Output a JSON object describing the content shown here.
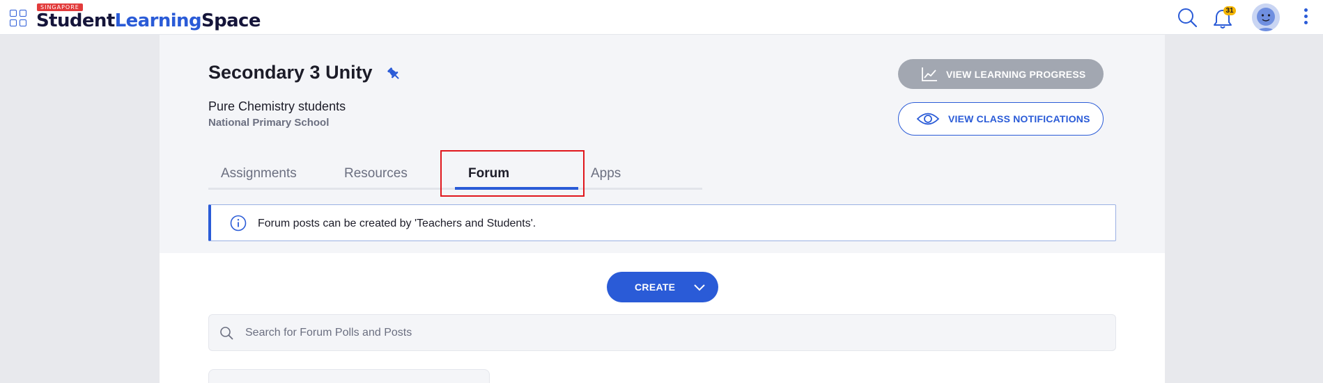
{
  "header": {
    "logo_badge": "SINGAPORE",
    "logo_word_1": "Student",
    "logo_word_2": "Learning",
    "logo_word_3": "Space",
    "notification_count": "31",
    "icons": [
      "apps-grid-icon",
      "search-icon",
      "bell-icon",
      "avatar",
      "more-vertical-icon"
    ]
  },
  "class": {
    "title": "Secondary 3 Unity",
    "subtitle": "Pure Chemistry students",
    "school": "National Primary School"
  },
  "actions": {
    "view_progress": "VIEW LEARNING PROGRESS",
    "view_notifications": "VIEW CLASS NOTIFICATIONS"
  },
  "tabs": [
    {
      "label": "Assignments",
      "active": false
    },
    {
      "label": "Resources",
      "active": false
    },
    {
      "label": "Forum",
      "active": true
    },
    {
      "label": "Apps",
      "active": false
    }
  ],
  "info_banner": {
    "text": "Forum posts can be created by 'Teachers and Students'."
  },
  "create": {
    "label": "CREATE"
  },
  "search": {
    "placeholder": "Search for Forum Polls and Posts",
    "value": ""
  },
  "colors": {
    "brand_blue": "#2a5bd7",
    "badge_red": "#e23b3b",
    "notif_yellow": "#f3b400",
    "disabled_gray": "#a2a7b1",
    "highlight_red": "#e0161c"
  }
}
